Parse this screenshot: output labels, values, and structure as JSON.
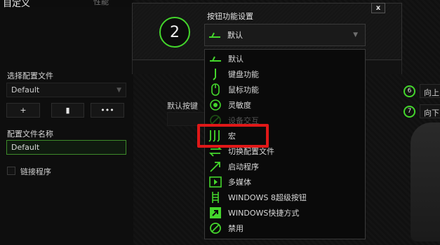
{
  "tab": {
    "title": "自定义",
    "sub": "性能"
  },
  "left": {
    "select_profile_label": "选择配置文件",
    "profile_value": "Default",
    "buttons": [
      "+",
      "▮",
      "•••"
    ],
    "profile_name_label": "配置文件名称",
    "profile_name_value": "Default",
    "link_program_label": "链接程序"
  },
  "center": {
    "default_key_label": "默认按键"
  },
  "right": {
    "items": [
      {
        "num": "6",
        "label": "向上"
      },
      {
        "num": "7",
        "label": "向下"
      }
    ]
  },
  "dialog": {
    "close_label": "x",
    "button_number": "2",
    "function_title": "按钮功能设置",
    "selected_value": "默认"
  },
  "dropdown": {
    "items": [
      {
        "label": "默认",
        "icon": "default-icon"
      },
      {
        "label": "键盘功能",
        "icon": "keyboard-icon"
      },
      {
        "label": "鼠标功能",
        "icon": "mouse-icon"
      },
      {
        "label": "灵敏度",
        "icon": "sensitivity-icon"
      },
      {
        "label": "设备交互",
        "icon": "device-interaction-icon"
      },
      {
        "label": "宏",
        "icon": "macro-icon"
      },
      {
        "label": "切换配置文件",
        "icon": "switch-profile-icon"
      },
      {
        "label": "启动程序",
        "icon": "launch-program-icon"
      },
      {
        "label": "多媒体",
        "icon": "multimedia-icon"
      },
      {
        "label": "WINDOWS 8超级按钮",
        "icon": "windows8-charms-icon"
      },
      {
        "label": "WINDOWS快捷方式",
        "icon": "windows-shortcut-icon"
      },
      {
        "label": "禁用",
        "icon": "disable-icon"
      }
    ]
  },
  "colors": {
    "accent": "#44d62c",
    "highlight": "#e01818"
  }
}
